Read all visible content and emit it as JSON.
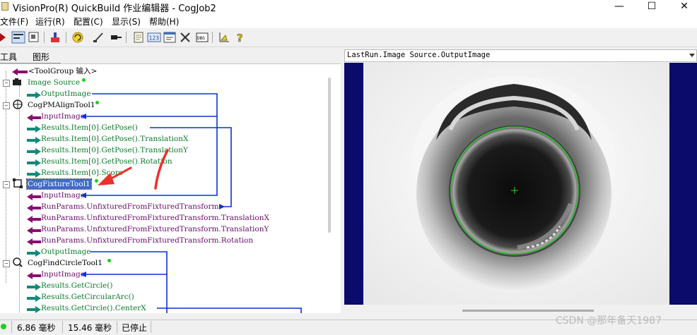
{
  "window": {
    "title": "VisionPro(R) QuickBuild 作业编辑器 - CogJob2",
    "min_glyph": "—",
    "max_glyph": "☐",
    "close_glyph": "✕"
  },
  "menu": [
    {
      "label": "文件(F)"
    },
    {
      "label": "运行(R)"
    },
    {
      "label": "配置(C)"
    },
    {
      "label": "显示(S)"
    },
    {
      "label": "帮助(H)"
    }
  ],
  "toolbar": {
    "icons": [
      "run-icon",
      "tool-display-icon",
      "image-display-icon",
      "import-icon",
      "cycle-icon",
      "edit-icon",
      "pin-icon",
      "notes-icon",
      "counter-icon",
      "terminal-icon",
      "tools-icon",
      "debug-icon",
      "calibrate-icon",
      "help-icon"
    ]
  },
  "tabs": [
    "工具",
    "图形"
  ],
  "tree": [
    {
      "text": "<ToolGroup 输入>",
      "kind": "purple",
      "type": "group"
    },
    {
      "text": "Image Source",
      "kind": "green",
      "type": "tool"
    },
    {
      "text": "OutputImage",
      "kind": "green",
      "type": "output"
    },
    {
      "text": "CogPMAlignTool1",
      "kind": "tool",
      "type": "tool"
    },
    {
      "text": "InputImage",
      "kind": "purple",
      "type": "input"
    },
    {
      "text": "Results.Item[0].GetPose()",
      "kind": "green",
      "type": "output"
    },
    {
      "text": "Results.Item[0].GetPose().TranslationX",
      "kind": "green",
      "type": "output"
    },
    {
      "text": "Results.Item[0].GetPose().TranslationY",
      "kind": "green",
      "type": "output"
    },
    {
      "text": "Results.Item[0].GetPose().Rotation",
      "kind": "green",
      "type": "output"
    },
    {
      "text": "Results.Item[0].Score",
      "kind": "green",
      "type": "output"
    },
    {
      "text": "CogFixtureTool1",
      "kind": "tool",
      "type": "tool",
      "selected": true
    },
    {
      "text": "InputImage",
      "kind": "purple",
      "type": "input"
    },
    {
      "text": "RunParams.UnfixturedFromFixturedTransform",
      "kind": "purple",
      "type": "input"
    },
    {
      "text": "RunParams.UnfixturedFromFixturedTransform.TranslationX",
      "kind": "purple",
      "type": "input"
    },
    {
      "text": "RunParams.UnfixturedFromFixturedTransform.TranslationY",
      "kind": "purple",
      "type": "input"
    },
    {
      "text": "RunParams.UnfixturedFromFixturedTransform.Rotation",
      "kind": "purple",
      "type": "input"
    },
    {
      "text": "OutputImage",
      "kind": "green",
      "type": "output"
    },
    {
      "text": "CogFindCircleTool1",
      "kind": "tool",
      "type": "tool"
    },
    {
      "text": "InputImage",
      "kind": "purple",
      "type": "input"
    },
    {
      "text": "Results.GetCircle()",
      "kind": "green",
      "type": "output"
    },
    {
      "text": "Results.GetCircularArc()",
      "kind": "green",
      "type": "output"
    },
    {
      "text": "Results.GetCircle().CenterX",
      "kind": "green",
      "type": "output"
    }
  ],
  "image_display": {
    "title": "LastRun.Image Source.OutputImage",
    "colors": {
      "frame": "#0b0b6b",
      "circle": "#22dd22"
    }
  },
  "status": {
    "time1": "6.86 毫秒",
    "time2": "15.46 毫秒",
    "state": "已停止"
  },
  "watermark": "CSDN @那年备天1987"
}
